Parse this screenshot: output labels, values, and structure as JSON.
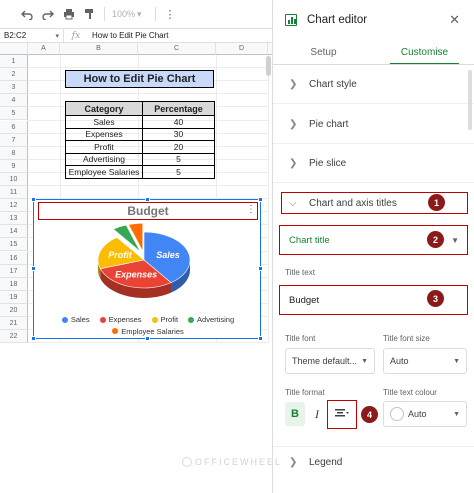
{
  "toolbar": {
    "zoom": "100%",
    "undo_icon": "undo-icon",
    "redo_icon": "redo-icon",
    "print_icon": "print-icon",
    "paint_format_icon": "paint-format-icon"
  },
  "formula_bar": {
    "name_box": "B2:C2",
    "fx": "fx",
    "formula": "How to Edit Pie Chart"
  },
  "columns": [
    "A",
    "B",
    "C",
    "D"
  ],
  "rows": [
    "1",
    "2",
    "3",
    "4",
    "5",
    "6",
    "7",
    "8",
    "9",
    "10",
    "11",
    "12",
    "13",
    "14",
    "15",
    "16",
    "17",
    "18",
    "19",
    "20",
    "21",
    "22"
  ],
  "sheet_title": "How to Edit Pie Chart",
  "table": {
    "headers": [
      "Category",
      "Percentage"
    ],
    "rows": [
      {
        "category": "Sales",
        "percentage": "40"
      },
      {
        "category": "Expenses",
        "percentage": "30"
      },
      {
        "category": "Profit",
        "percentage": "20"
      },
      {
        "category": "Advertising",
        "percentage": "5"
      },
      {
        "category": "Employee Salaries",
        "percentage": "5"
      }
    ]
  },
  "chart_data": {
    "type": "pie",
    "title": "Budget",
    "categories": [
      "Sales",
      "Expenses",
      "Profit",
      "Advertising",
      "Employee Salaries"
    ],
    "values": [
      40,
      30,
      20,
      5,
      5
    ],
    "colors": [
      "#4285f4",
      "#ea4335",
      "#fbbc04",
      "#34a853",
      "#ff6d01"
    ],
    "slice_labels": [
      "Sales",
      "Expenses",
      "Profit",
      "",
      ""
    ],
    "legend_position": "bottom",
    "style": "3d"
  },
  "editor": {
    "title": "Chart editor",
    "close_icon": "close-icon",
    "tabs": [
      {
        "label": "Setup",
        "active": false
      },
      {
        "label": "Customise",
        "active": true
      }
    ],
    "sections": [
      {
        "label": "Chart style"
      },
      {
        "label": "Pie chart"
      },
      {
        "label": "Pie slice"
      },
      {
        "label": "Chart and axis titles"
      }
    ],
    "chart_title_select": "Chart title",
    "title_text_label": "Title text",
    "title_text_value": "Budget",
    "title_font_label": "Title font",
    "title_font_value": "Theme default...",
    "title_font_size_label": "Title font size",
    "title_font_size_value": "Auto",
    "title_format_label": "Title format",
    "bold_label": "B",
    "italic_label": "I",
    "title_text_colour_label": "Title text colour",
    "title_text_colour_value": "Auto",
    "legend_label": "Legend"
  },
  "annotations": [
    "1",
    "2",
    "3",
    "4"
  ],
  "accent_color": "#188038",
  "highlight_color": "#c00000",
  "watermark": "OFFICEWHEEL"
}
